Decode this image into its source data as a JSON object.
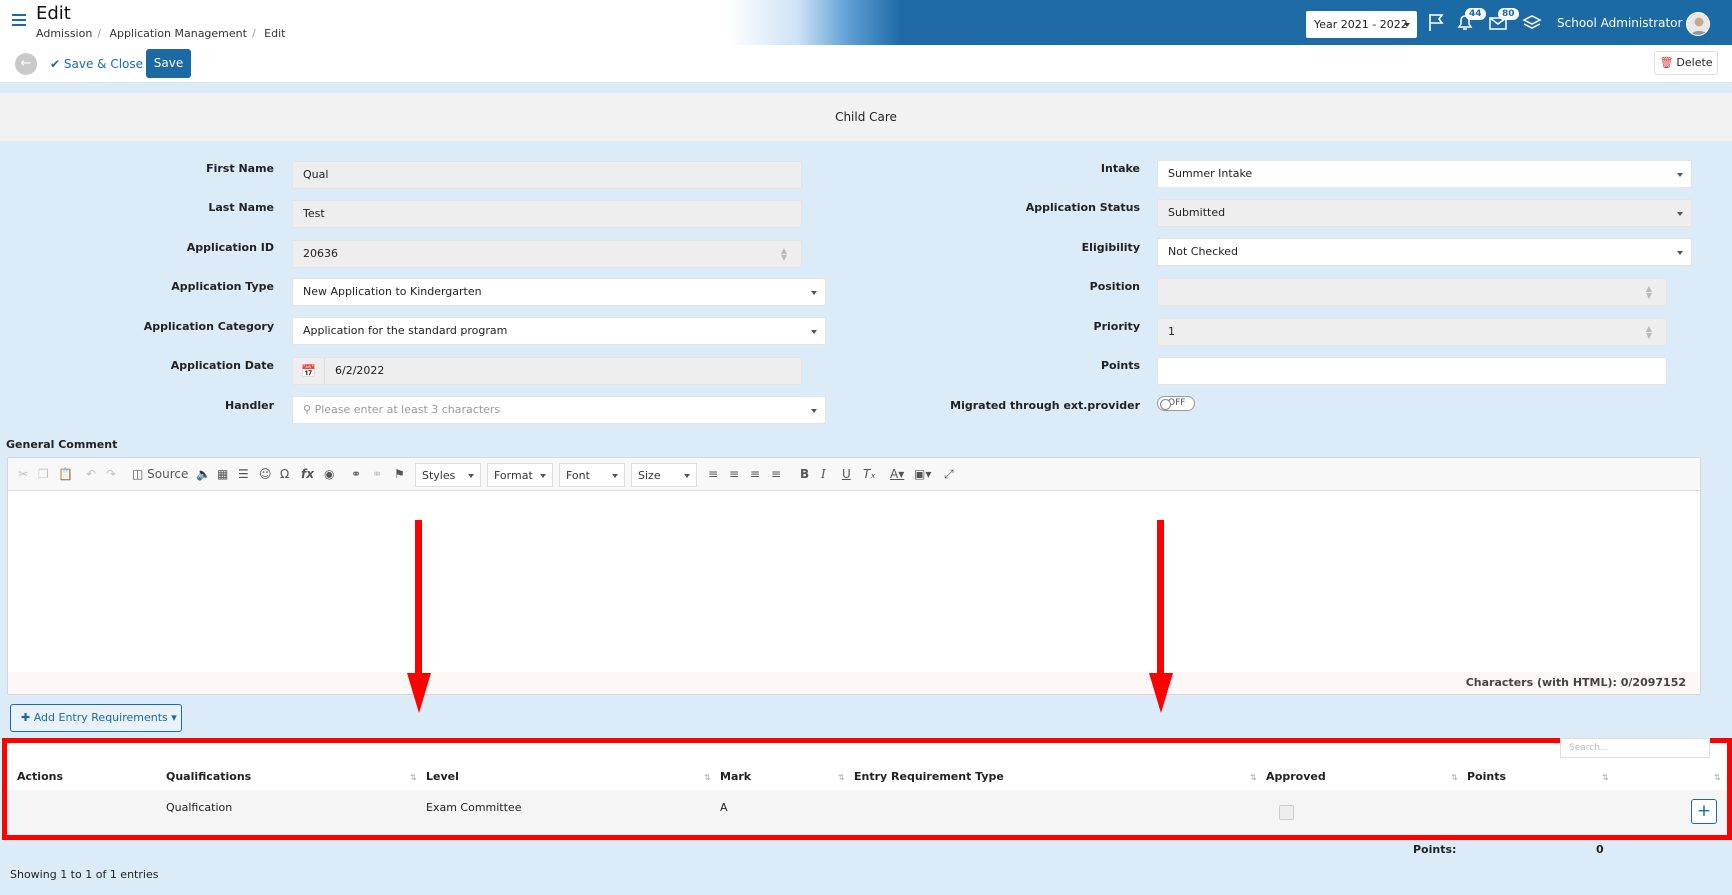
{
  "header": {
    "title": "Edit",
    "breadcrumb": [
      "Admission",
      "Application Management",
      "Edit"
    ],
    "year": "Year 2021 - 2022",
    "notifications_count": "44",
    "messages_count": "80",
    "user": "School Administrator"
  },
  "toolbar": {
    "save_close": "Save & Close",
    "save": "Save",
    "delete": "Delete"
  },
  "section_title": "Child Care",
  "form": {
    "first_name_label": "First Name",
    "first_name": "Qual",
    "last_name_label": "Last Name",
    "last_name": "Test",
    "app_id_label": "Application ID",
    "app_id": "20636",
    "app_type_label": "Application Type",
    "app_type": "New Application to Kindergarten",
    "app_category_label": "Application Category",
    "app_category": "Application for the standard program",
    "app_date_label": "Application Date",
    "app_date": "6/2/2022",
    "handler_label": "Handler",
    "handler_placeholder": "Please enter at least 3 characters",
    "intake_label": "Intake",
    "intake": "Summer Intake",
    "status_label": "Application Status",
    "status": "Submitted",
    "eligibility_label": "Eligibility",
    "eligibility": "Not Checked",
    "position_label": "Position",
    "position": "",
    "priority_label": "Priority",
    "priority": "1",
    "points_label": "Points",
    "points": "",
    "migrated_label": "Migrated through ext.provider",
    "migrated": "OFF"
  },
  "editor": {
    "label": "General Comment",
    "source": "Source",
    "styles": "Styles",
    "format": "Format",
    "font": "Font",
    "size": "Size",
    "char_count": "Characters (with HTML): 0/2097152"
  },
  "entry": {
    "add_button": "Add Entry Requirements",
    "search_placeholder": "Search...",
    "columns": [
      "Actions",
      "Qualifications",
      "Level",
      "Mark",
      "Entry Requirement Type",
      "Approved",
      "Points"
    ],
    "rows": [
      {
        "actions": "",
        "qualification": "Qualfication",
        "level": "Exam Committee",
        "mark": "A",
        "type": "",
        "points": ""
      }
    ],
    "points_label": "Points:",
    "points_total": "0",
    "showing": "Showing 1 to 1 of 1 entries"
  },
  "colors": {
    "brand": "#1b6aa3",
    "annotation": "#ff0000"
  }
}
